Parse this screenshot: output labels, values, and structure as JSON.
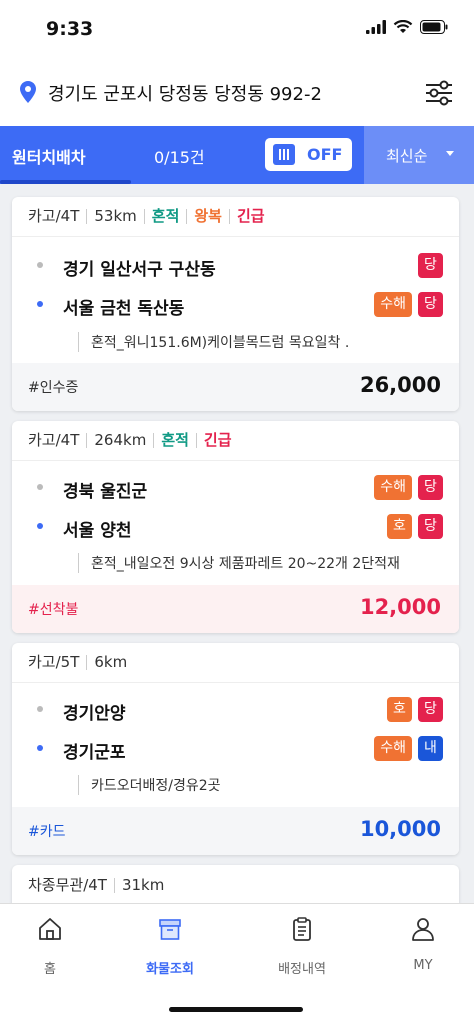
{
  "status": {
    "time": "9:33"
  },
  "address": {
    "text": "경기도 군포시 당정동 당정동 992-2"
  },
  "topbar": {
    "label": "원터치배차",
    "count": "0/15건",
    "toggle": "OFF",
    "sort": "최신순"
  },
  "cards": [
    {
      "tags": [
        "카고/4T",
        "53km",
        "혼적",
        "왕복",
        "긴급"
      ],
      "from": "경기 일산서구 구산동",
      "from_badges": [
        "당"
      ],
      "to": "서울 금천 독산동",
      "to_badges": [
        "수해",
        "당"
      ],
      "memo": "혼적_워니151.6M)케이블목드럼 목요일착 .",
      "pay": "#인수증",
      "price": "26,000"
    },
    {
      "tags": [
        "카고/4T",
        "264km",
        "혼적",
        "긴급"
      ],
      "from": "경북 울진군",
      "from_badges": [
        "수해",
        "당"
      ],
      "to": "서울 양천",
      "to_badges": [
        "호",
        "당"
      ],
      "memo": "혼적_내일오전 9시상 제품파레트 20~22개 2단적재",
      "pay": "#선착불",
      "price": "12,000"
    },
    {
      "tags": [
        "카고/5T",
        "6km"
      ],
      "from": "경기안양",
      "from_badges": [
        "호",
        "당"
      ],
      "to": "경기군포",
      "to_badges": [
        "수해",
        "내"
      ],
      "memo": "카드오더배정/경유2곳",
      "pay": "#카드",
      "price": "10,000"
    },
    {
      "tags": [
        "차종무관/4T",
        "31km"
      ]
    }
  ],
  "nav": {
    "home": "홈",
    "cargo": "화물조회",
    "history": "배정내역",
    "my": "MY"
  },
  "colors": {
    "primary": "#3d6bf5",
    "red": "#e4224d",
    "orange": "#f07233",
    "teal": "#119a85",
    "blue": "#1a56d9"
  },
  "icons": [
    "signal-icon",
    "wifi-icon",
    "battery-icon",
    "location-pin-icon",
    "filter-sliders-icon",
    "home-icon",
    "box-icon",
    "clipboard-icon",
    "user-icon"
  ]
}
